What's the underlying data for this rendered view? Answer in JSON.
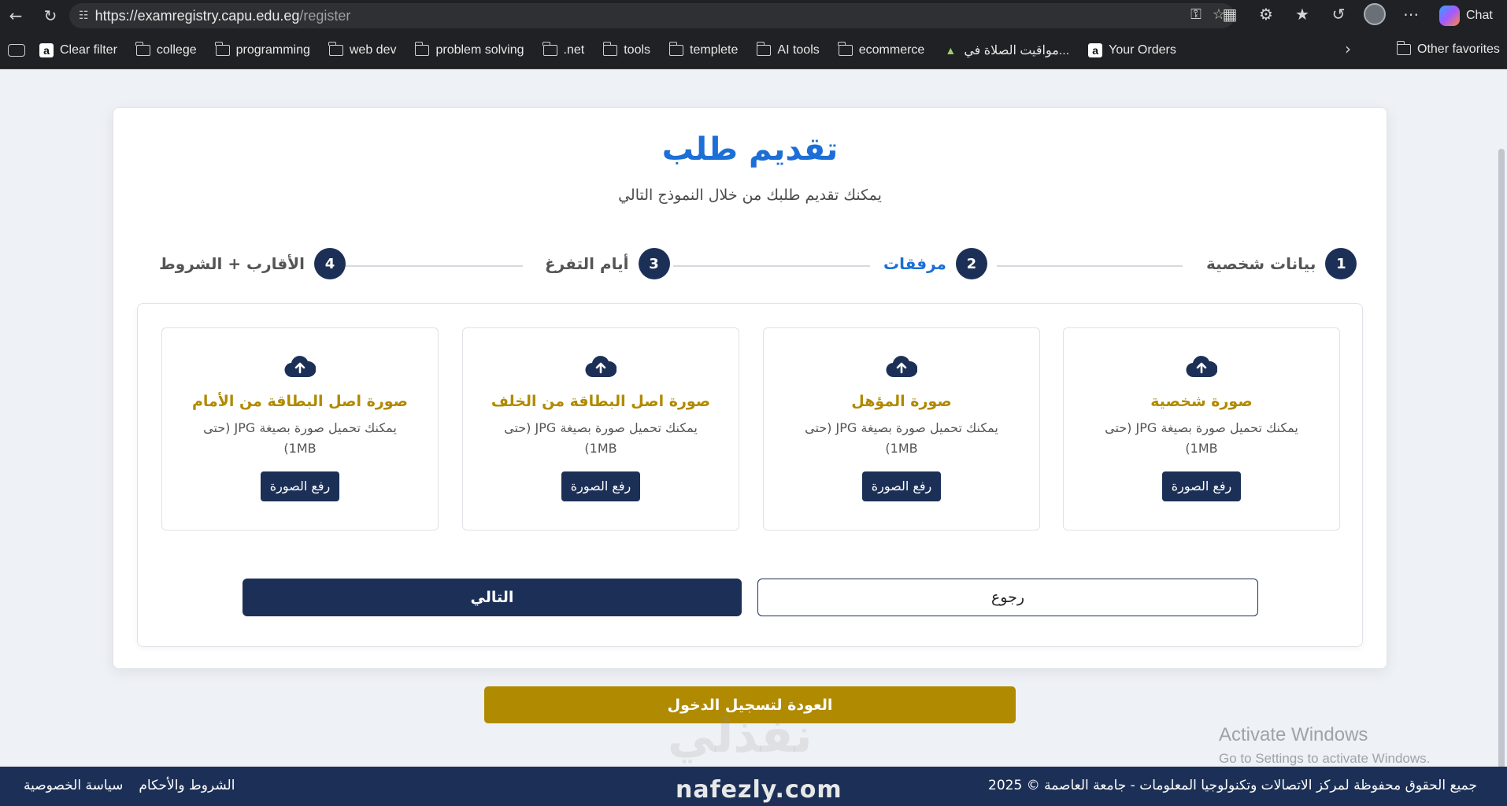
{
  "browser": {
    "url_host": "https://examregistry.capu.edu.eg",
    "url_path": "/register",
    "chat_label": "Chat",
    "bookmarks": [
      {
        "label": "Clear filter",
        "icon": "amazon-icon"
      },
      {
        "label": "college",
        "icon": "folder-icon"
      },
      {
        "label": "programming",
        "icon": "folder-icon"
      },
      {
        "label": "web dev",
        "icon": "folder-icon"
      },
      {
        "label": "problem solving",
        "icon": "folder-icon"
      },
      {
        "label": ".net",
        "icon": "folder-icon"
      },
      {
        "label": "tools",
        "icon": "folder-icon"
      },
      {
        "label": "templete",
        "icon": "folder-icon"
      },
      {
        "label": "AI tools",
        "icon": "folder-icon"
      },
      {
        "label": "ecommerce",
        "icon": "folder-icon"
      },
      {
        "label": "مواقيت الصلاة في...",
        "icon": "mosque-icon"
      },
      {
        "label": "Your Orders",
        "icon": "amazon-icon"
      }
    ],
    "other_favorites": "Other favorites"
  },
  "page": {
    "title": "تقديم طلب",
    "subtitle": "يمكنك تقديم طلبك من خلال النموذج التالي",
    "steps": [
      {
        "num": "1",
        "label": "بيانات شخصية",
        "active": false
      },
      {
        "num": "2",
        "label": "مرفقات",
        "active": true
      },
      {
        "num": "3",
        "label": "أيام التفرغ",
        "active": false
      },
      {
        "num": "4",
        "label": "الأقارب + الشروط",
        "active": false
      }
    ],
    "uploads": [
      {
        "title": "صورة شخصية",
        "desc": "يمكنك تحميل صورة بصيغة JPG (حتى 1MB)",
        "button": "رفع الصورة"
      },
      {
        "title": "صورة المؤهل",
        "desc": "يمكنك تحميل صورة بصيغة JPG (حتى 1MB)",
        "button": "رفع الصورة"
      },
      {
        "title": "صورة اصل البطاقة من الخلف",
        "desc": "يمكنك تحميل صورة بصيغة JPG (حتى 1MB)",
        "button": "رفع الصورة"
      },
      {
        "title": "صورة اصل البطاقة من الأمام",
        "desc": "يمكنك تحميل صورة بصيغة JPG (حتى 1MB)",
        "button": "رفع الصورة"
      }
    ],
    "back_label": "رجوع",
    "next_label": "التالي",
    "login_back_label": "العودة لتسجيل الدخول"
  },
  "watermark": {
    "arabic": "نفذلي",
    "english": "nafezly.com"
  },
  "activate_windows": {
    "line1": "Activate Windows",
    "line2": "Go to Settings to activate Windows."
  },
  "footer": {
    "copyright": "جميع الحقوق محفوظة لمركز الاتصالات وتكنولوجيا المعلومات - جامعة العاصمة © 2025",
    "terms": "الشروط والأحكام",
    "privacy": "سياسة الخصوصية"
  },
  "colors": {
    "primary_navy": "#1c3057",
    "title_blue": "#1c6fd6",
    "gold": "#b08a00"
  }
}
